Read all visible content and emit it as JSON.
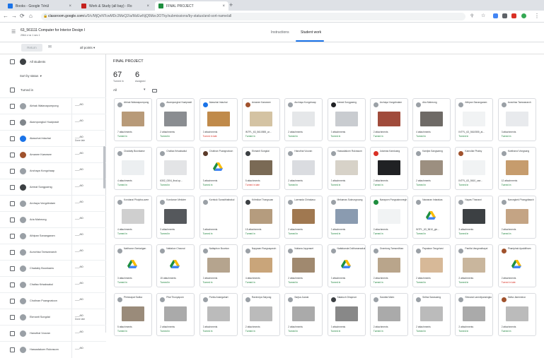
{
  "browser": {
    "tabs": [
      {
        "label": "Books - Google Térül",
        "color": "#1a73e8",
        "active": false
      },
      {
        "label": "Work & Study (all bay) - Ro",
        "color": "#c5221f",
        "active": false
      },
      {
        "label": "FINAL PROJECT",
        "color": "#1e8e3e",
        "active": true
      }
    ],
    "new_tab": "+",
    "url_domain": "classroom.google.com",
    "url_path": "/u/0/c/MjQxNTcwMDc3MzQ2/a/MzEwNjQ5Mzc3OTky/submissions/by-status/and-sort-name/all",
    "extension_colors": [
      "#5f6368",
      "#fbbc04",
      "#4285f4",
      "#d93025",
      "#34a853"
    ]
  },
  "appbar": {
    "title": "63_561111 Computer for Interior Design I",
    "subtitle": "2564 ภาค 1 sec 1",
    "tab_instructions": "Instructions",
    "tab_student_work": "Student work"
  },
  "toolbar": {
    "return_label": "Return",
    "points_label": "all points"
  },
  "left": {
    "all_students": "All students",
    "sort_label": "Sort by status",
    "turned_in_header": "Turned in",
    "students": [
      {
        "name": "Abhak Watanapumpong",
        "grade": "___/40",
        "note": ""
      },
      {
        "name": "Akampongkul Huaiprasit",
        "grade": "___/40",
        "note": ""
      },
      {
        "name": "Akaschai Intachai",
        "grade": "___/40",
        "note": "Done late"
      },
      {
        "name": "Amanee Kaewsee",
        "grade": "___/40",
        "note": ""
      },
      {
        "name": "Anchaya Kongchaap",
        "grade": "___/40",
        "note": ""
      },
      {
        "name": "Areeat Songpaeng",
        "grade": "___/40",
        "note": ""
      },
      {
        "name": "Archaya Vongdindam",
        "grade": "___/40",
        "note": ""
      },
      {
        "name": "Aria Maheong",
        "grade": "___/40",
        "note": ""
      },
      {
        "name": "Athipan Sanangaram",
        "grade": "___/40",
        "note": ""
      },
      {
        "name": "Aunchisa Tamwanarch",
        "grade": "___/40",
        "note": ""
      },
      {
        "name": "Chadaby Boonkaew",
        "grade": "___/40",
        "note": ""
      },
      {
        "name": "Chalisa Krisaksakul",
        "grade": "___/40",
        "note": ""
      },
      {
        "name": "Chutinan Puangnatoon",
        "grade": "___/40",
        "note": ""
      },
      {
        "name": "Ekmanit Sungdai",
        "grade": "___/40",
        "note": "Done late"
      },
      {
        "name": "Hanuthai Voovan",
        "grade": "___/40",
        "note": ""
      },
      {
        "name": "Hassadakorn Rukrasom",
        "grade": "___/40",
        "note": ""
      }
    ],
    "avatar_colors": [
      "#9aa0a6",
      "#80868b",
      "#1a73e8",
      "#a0522d",
      "#9aa0a6",
      "#3c4043",
      "#9aa0a6",
      "#9aa0a6",
      "#9aa0a6",
      "#9aa0a6",
      "#9aa0a6",
      "#9aa0a6",
      "#9aa0a6",
      "#9aa0a6",
      "#9aa0a6",
      "#9aa0a6"
    ]
  },
  "main": {
    "title": "FINAL PROJECT",
    "turned_in_count": "67",
    "turned_in_label": "Turned in",
    "assigned_count": "6",
    "assigned_label": "Assigned",
    "filter": "All",
    "cards": [
      {
        "name": "Abhak Watanapumpong",
        "att": "7 attachments",
        "status": "Turned in",
        "thumb": "#b89a78",
        "av": "#9aa0a6"
      },
      {
        "name": "Akampongkul Huaiprasit",
        "att": "2 attachments",
        "status": "Turned in",
        "thumb": "#8a8d91",
        "av": "#9aa0a6"
      },
      {
        "name": "Akaschai Intachai",
        "att": "2 attachments",
        "status": "Turned in late",
        "thumb": "#c08a4a",
        "av": "#1a73e8"
      },
      {
        "name": "Amanee Kaewsee",
        "att": "INTFL_63_5610555_ar...",
        "status": "Turned in",
        "thumb": "#d4c3a3",
        "av": "#a0522d"
      },
      {
        "name": "Anchaya Kongchaap",
        "att": "2 attachments",
        "status": "Turned in",
        "thumb": "#e5e7e9",
        "av": "#9aa0a6"
      },
      {
        "name": "Areeat Songpaeng",
        "att": "2 attachments",
        "status": "Turned in",
        "thumb": "#c9ccd0",
        "av": "#202124"
      },
      {
        "name": "Archaya Vongdindam",
        "att": "2 attachments",
        "status": "Turned in",
        "thumb": "#a04b3b",
        "av": "#9aa0a6"
      },
      {
        "name": "Aria Maheong",
        "att": "4 attachments",
        "status": "Turned in",
        "thumb": "#6e6a66",
        "av": "#9aa0a6"
      },
      {
        "name": "Athipan Sanangaram",
        "att": "INTFL_63_5610555_at...",
        "status": "Turned in",
        "thumb": "#f1f3f4",
        "av": "#9aa0a6"
      },
      {
        "name": "Aunchisa Tamwanarch",
        "att": "3 attachments",
        "status": "Turned in",
        "thumb": "#e8eaed",
        "av": "#9aa0a6"
      },
      {
        "name": "Chadaby Boonkaew",
        "att": "4 attachments",
        "status": "Turned in",
        "thumb": "#eceff1",
        "av": "#9aa0a6"
      },
      {
        "name": "Chalisa Krisaksakul",
        "att": "6302_0304_final.cp...",
        "status": "Turned in",
        "thumb": "#e3e4e6",
        "av": "#9aa0a6"
      },
      {
        "name": "Chutinan Puangnatoon",
        "att": "3 attachments",
        "status": "Turned in",
        "thumb": "#ffffff",
        "av": "#5b3a29",
        "logo": true
      },
      {
        "name": "Ekmanit Sungdai",
        "att": "5 attachments",
        "status": "Turned in late",
        "thumb": "#7a6a55",
        "av": "#3c4043"
      },
      {
        "name": "Hanuthai Voovan",
        "att": "2 attachments",
        "status": "Turned in",
        "thumb": "#dadce0",
        "av": "#9aa0a6"
      },
      {
        "name": "Hassadakorn Rukrasom",
        "att": "2 attachments",
        "status": "Turned in",
        "thumb": "#d7d2c8",
        "av": "#9aa0a6"
      },
      {
        "name": "Jutamas Kaeduang",
        "att": "2 attachments",
        "status": "Turned in",
        "thumb": "#202124",
        "av": "#d93025"
      },
      {
        "name": "Kamjira Sangsaeng",
        "att": "2 attachments",
        "status": "Turned in",
        "thumb": "#9c8f80",
        "av": "#9aa0a6"
      },
      {
        "name": "Kamollar Phaisy",
        "att": "INTFL_63_5610_use...",
        "status": "Turned in",
        "thumb": "#f1f3f4",
        "av": "#a0522d"
      },
      {
        "name": "Kanthanol Vongsang",
        "att": "12 attachments",
        "status": "Turned in",
        "thumb": "#c69c6d",
        "av": "#9aa0a6"
      },
      {
        "name": "Kondanai Pholpha-avee",
        "att": "4 attachments",
        "status": "Turned in",
        "thumb": "#cfcfcf",
        "av": "#9aa0a6"
      },
      {
        "name": "Kondanon Mekdee",
        "att": "3 attachments",
        "status": "Turned in",
        "thumb": "#55585c",
        "av": "#9aa0a6"
      },
      {
        "name": "Kornkuk Surasithatirakul",
        "att": "3 attachments",
        "status": "Turned in",
        "thumb": "#ffffff",
        "av": "#9aa0a6"
      },
      {
        "name": "Kritmikar Thongsuan",
        "att": "15 attachments",
        "status": "Turned in",
        "thumb": "#b59c7e",
        "av": "#3c4043"
      },
      {
        "name": "Laemada Chirakasu",
        "att": "2 attachments",
        "status": "Turned in",
        "thumb": "#a07850",
        "av": "#9aa0a6"
      },
      {
        "name": "Mekamas Sukrungruang",
        "att": "2 attachments",
        "status": "Turned in",
        "thumb": "#8a9bb0",
        "av": "#9aa0a6"
      },
      {
        "name": "Naraporn Pongsaknonegh",
        "att": "2 attachments",
        "status": "Turned in",
        "thumb": "#f1f3f4",
        "av": "#1e8e3e"
      },
      {
        "name": "Nawanan Intarakas",
        "att": "INTFL_63_5610_gin...",
        "status": "Turned in",
        "thumb": "#ffffff",
        "av": "#9aa0a6",
        "logo": true
      },
      {
        "name": "Napas Thanasri",
        "att": "3 attachments",
        "status": "Turned in",
        "thumb": "#3c4043",
        "av": "#9aa0a6"
      },
      {
        "name": "Narongkek Phongpitaach",
        "att": "2 attachments",
        "status": "Turned in",
        "thumb": "#c4a484",
        "av": "#9aa0a6"
      },
      {
        "name": "Nattharon Sentadgan",
        "att": "3 attachments",
        "status": "Turned in",
        "thumb": "#ffffff",
        "av": "#9aa0a6",
        "logo": true
      },
      {
        "name": "Nattakon Chaovai",
        "att": "15 attachments",
        "status": "Turned in",
        "thumb": "#ffffff",
        "av": "#9aa0a6",
        "logo": true
      },
      {
        "name": "Nattaphon Boonton",
        "att": "2 attachments",
        "status": "Turned in",
        "thumb": "#b5a48e",
        "av": "#9aa0a6"
      },
      {
        "name": "Nappaan Rungsayanch",
        "att": "4 attachments",
        "status": "Turned in",
        "thumb": "#c9a57a",
        "av": "#9aa0a6"
      },
      {
        "name": "Nuttana Jaypraset",
        "att": "2 attachments",
        "status": "Turned in",
        "thumb": "#a0896f",
        "av": "#9aa0a6"
      },
      {
        "name": "Nattakanda Dolthanarsakul",
        "att": "2 attachments",
        "status": "Turned in",
        "thumb": "#ffffff",
        "av": "#9aa0a6",
        "logo": true
      },
      {
        "name": "Oramtung Tamsedthan",
        "att": "2 attachments",
        "status": "Turned in",
        "thumb": "#b9a58b",
        "av": "#9aa0a6"
      },
      {
        "name": "Papaiaon Tangchavi",
        "att": "2 attachments",
        "status": "Turned in",
        "thumb": "#d7b998",
        "av": "#9aa0a6"
      },
      {
        "name": "Pantita Vangmathayei",
        "att": "2 attachments",
        "status": "Turned in",
        "thumb": "#c9b69d",
        "av": "#9aa0a6"
      },
      {
        "name": "Phaniphak Apaiditham",
        "att": "2 attachments",
        "status": "Turned in late",
        "thumb": "#ffffff",
        "av": "#a0522d",
        "logo": true
      },
      {
        "name": "Phimnapat Sarika",
        "att": "5 attachments",
        "status": "Turned in",
        "thumb": "#9a8b7a",
        "av": "#9aa0a6"
      },
      {
        "name": "Pilai Thunyaporn",
        "att": "2 attachments",
        "status": "Turned in",
        "thumb": "#aaa",
        "av": "#9aa0a6"
      },
      {
        "name": "Ponlia Anaegahart",
        "att": "2 attachments",
        "status": "Turned in",
        "thumb": "#bbb",
        "av": "#9aa0a6"
      },
      {
        "name": "Ravinnipa Saiyong",
        "att": "2 attachments",
        "status": "Turned in",
        "thumb": "#bbb",
        "av": "#9aa0a6"
      },
      {
        "name": "Sarjsa Juanai",
        "att": "2 attachments",
        "status": "Turned in",
        "thumb": "#aaa",
        "av": "#9aa0a6"
      },
      {
        "name": "Sataruch Dhapnorr",
        "att": "2 attachments",
        "status": "Turned in",
        "thumb": "#888",
        "av": "#3c4043"
      },
      {
        "name": "Saruttai Mahn",
        "att": "2 attachments",
        "status": "Turned in",
        "thumb": "#aaa",
        "av": "#9aa0a6"
      },
      {
        "name": "Selina Sarasaeng",
        "att": "2 attachments",
        "status": "Turned in",
        "thumb": "#bbb",
        "av": "#9aa0a6"
      },
      {
        "name": "Shinarat Lamnilyansingko",
        "att": "2 attachments",
        "status": "Turned in",
        "thumb": "#aaa",
        "av": "#9aa0a6"
      },
      {
        "name": "Sidha Jiaemnirun",
        "att": "2 attachments",
        "status": "Turned in",
        "thumb": "#bbb",
        "av": "#a0522d"
      }
    ]
  }
}
